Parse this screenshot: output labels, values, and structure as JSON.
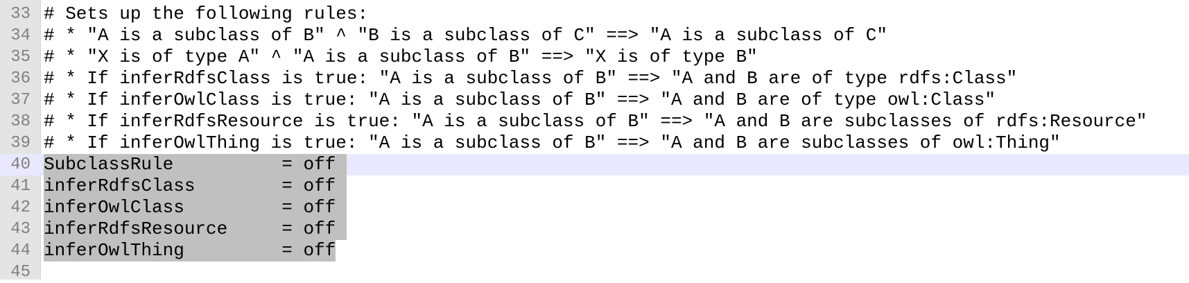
{
  "editor": {
    "lines": [
      {
        "number": "33",
        "text": "# Sets up the following rules:"
      },
      {
        "number": "34",
        "text": "# * \"A is a subclass of B\" ^ \"B is a subclass of C\" ==> \"A is a subclass of C\""
      },
      {
        "number": "35",
        "text": "# * \"X is of type A\" ^ \"A is a subclass of B\" ==> \"X is of type B\""
      },
      {
        "number": "36",
        "text": "# * If inferRdfsClass is true: \"A is a subclass of B\" ==> \"A and B are of type rdfs:Class\""
      },
      {
        "number": "37",
        "text": "# * If inferOwlClass is true: \"A is a subclass of B\" ==> \"A and B are of type owl:Class\""
      },
      {
        "number": "38",
        "text": "# * If inferRdfsResource is true: \"A is a subclass of B\" ==> \"A and B are subclasses of rdfs:Resource\""
      },
      {
        "number": "39",
        "text": "# * If inferOwlThing is true: \"A is a subclass of B\" ==> \"A and B are subclasses of owl:Thing\""
      },
      {
        "number": "40",
        "text": "SubclassRule          = off "
      },
      {
        "number": "41",
        "text": "inferRdfsClass        = off "
      },
      {
        "number": "42",
        "text": "inferOwlClass         = off "
      },
      {
        "number": "43",
        "text": "inferRdfsResource     = off "
      },
      {
        "number": "44",
        "text": "inferOwlThing         = off"
      },
      {
        "number": "45",
        "text": ""
      }
    ]
  },
  "colors": {
    "gutter_background": "#e4e4e4",
    "line_number": "#808080",
    "current_line_highlight": "#e8e8ff",
    "selection": "#c0c0c0"
  }
}
